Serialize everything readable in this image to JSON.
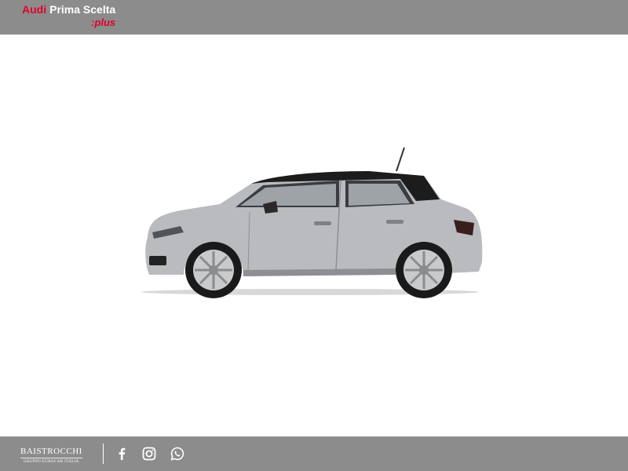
{
  "header": {
    "brand_audi": "Audi",
    "brand_prima": "Prima Scelta",
    "brand_plus": ":plus"
  },
  "hero": {
    "image_icon": "car-side-view-icon",
    "car_color": "#b9bbbe",
    "roof_color": "#1c1c1c"
  },
  "footer": {
    "dealer_name": "BAISTROCCHI",
    "dealer_sub": "GRUPPO EUROCAR ITALIA",
    "social": [
      {
        "icon": "facebook-icon"
      },
      {
        "icon": "instagram-icon"
      },
      {
        "icon": "whatsapp-icon"
      }
    ]
  },
  "colors": {
    "bar_bg": "#8c8c8c",
    "accent_red": "#e3002b",
    "text_white": "#ffffff"
  }
}
